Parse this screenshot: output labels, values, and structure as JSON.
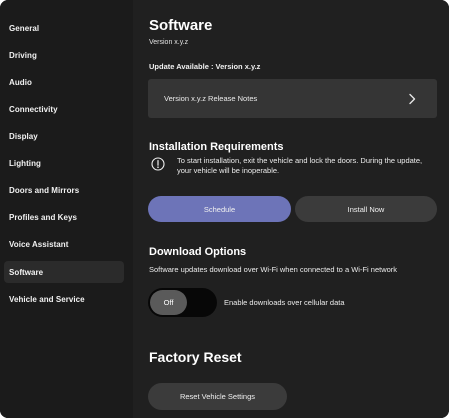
{
  "sidebar": {
    "items": [
      {
        "label": "General",
        "active": false
      },
      {
        "label": "Driving",
        "active": false
      },
      {
        "label": "Audio",
        "active": false
      },
      {
        "label": "Connectivity",
        "active": false
      },
      {
        "label": "Display",
        "active": false
      },
      {
        "label": "Lighting",
        "active": false
      },
      {
        "label": "Doors and Mirrors",
        "active": false
      },
      {
        "label": "Profiles and Keys",
        "active": false
      },
      {
        "label": "Voice Assistant",
        "active": false
      },
      {
        "label": "Software",
        "active": true
      },
      {
        "label": "Vehicle and Service",
        "active": false
      }
    ]
  },
  "software": {
    "title": "Software",
    "version": "Version x.y.z",
    "update_available": "Update Available : Version x.y.z",
    "release_notes_label": "Version x.y.z Release Notes",
    "release_notes_icon": "chevron-right-icon"
  },
  "installation": {
    "title": "Installation Requirements",
    "icon": "info-icon",
    "text": "To start installation, exit the vehicle and lock the doors. During the update, your vehicle will be inoperable.",
    "schedule_label": "Schedule",
    "install_label": "Install Now"
  },
  "download": {
    "title": "Download Options",
    "description": "Software updates download over Wi-Fi when connected to a Wi-Fi network",
    "toggle_state": "Off",
    "toggle_label": "Enable downloads over cellular data"
  },
  "factory_reset": {
    "title": "Factory Reset",
    "button_label": "Reset Vehicle Settings"
  },
  "colors": {
    "background": "#1e1e1e",
    "sidebar": "#1b1b1b",
    "panel": "#353535",
    "accent": "#6d74b8",
    "button": "#3b3b3b"
  }
}
